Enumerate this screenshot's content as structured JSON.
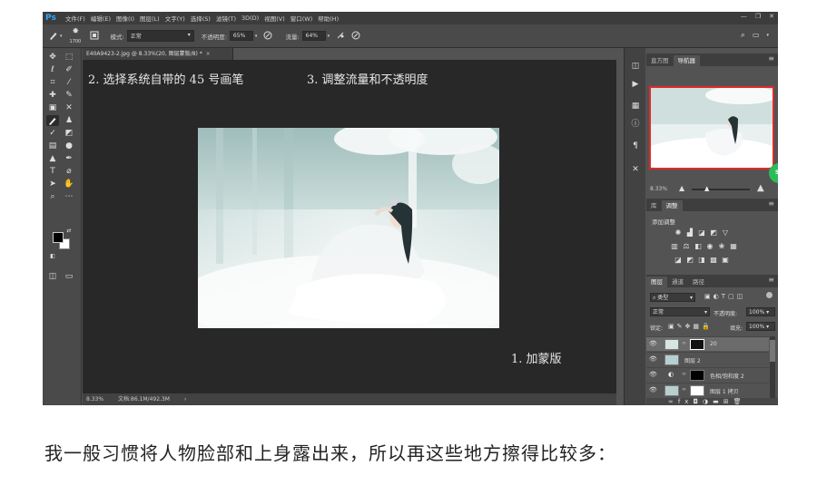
{
  "app": {
    "logo": "Ps",
    "menu": [
      "文件(F)",
      "编辑(E)",
      "图像(I)",
      "图层(L)",
      "文字(Y)",
      "选择(S)",
      "滤镜(T)",
      "3D(D)",
      "视图(V)",
      "窗口(W)",
      "帮助(H)"
    ],
    "window_controls": [
      "—",
      "❐",
      "✕"
    ]
  },
  "options_bar": {
    "brush_size": "1700",
    "mode_label": "模式:",
    "mode_value": "正常",
    "opacity_label": "不透明度:",
    "opacity_value": "65%",
    "flow_label": "流量:",
    "flow_value": "64%"
  },
  "document": {
    "tab_title": "E40A9423-2.jpg @ 8.33%(20, 图层蒙版/8) *",
    "tab_close": "×",
    "zoom": "8.33%",
    "doc_size": "文档:86.1M/492.3M"
  },
  "annotations": {
    "step2": "2. 选择系统自带的 45 号画笔",
    "step3": "3. 调整流量和不透明度",
    "step1": "1. 加蒙版"
  },
  "panels": {
    "top_tabs": [
      "直方图",
      "导航器"
    ],
    "active_top_tab": 1,
    "navigator_zoom": "8.33%",
    "adjust_tabs": [
      "库",
      "调整"
    ],
    "adjust_title": "添加调整",
    "layer_tabs": [
      "图层",
      "通道",
      "路径"
    ],
    "kind_filter": "类型",
    "blend_mode": "正常",
    "opacity_label": "不透明度:",
    "opacity_value": "100%",
    "lock_label": "锁定:",
    "fill_label": "填充:",
    "fill_value": "100%",
    "layers": [
      {
        "name": "20"
      },
      {
        "name": "图层 2"
      },
      {
        "name": "色相/饱和度 2"
      },
      {
        "name": "图层 1 拷贝"
      }
    ]
  },
  "caption": "我一般习惯将人物脸部和上身露出来，所以再这些地方擦得比较多："
}
